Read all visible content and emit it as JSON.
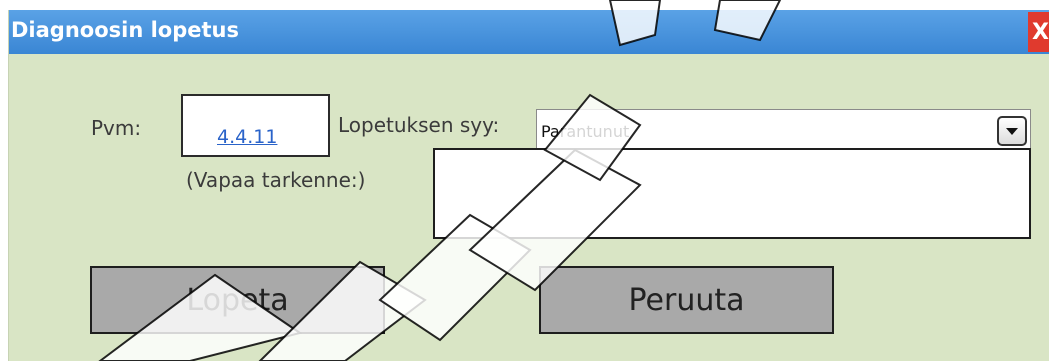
{
  "window": {
    "title": "Diagnoosin lopetus",
    "close_label": "X"
  },
  "form": {
    "date_label": "Pvm:",
    "date_value": "4.4.11",
    "reason_label": "Lopetuksen syy:",
    "reason_value": "Parantunut",
    "free_text_label": "(Vapaa tarkenne:)",
    "free_text_value": ""
  },
  "buttons": {
    "finish_label": "Lopeta",
    "cancel_label": "Peruuta"
  },
  "colors": {
    "titlebar": "#3a86d4",
    "background": "#d9e5c5",
    "close": "#e03a2e",
    "button": "#a9a9a9",
    "link": "#2a63c9"
  }
}
